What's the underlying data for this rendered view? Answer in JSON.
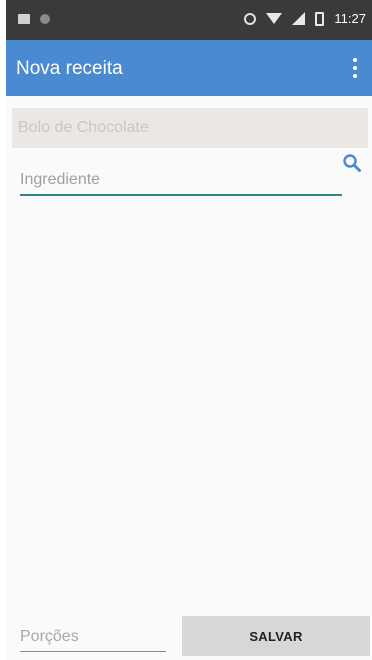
{
  "status_bar": {
    "time": "11:27",
    "icons": [
      "image-icon",
      "circle-icon",
      "alarm-icon",
      "wifi-icon",
      "signal-icon",
      "battery-icon"
    ]
  },
  "app_bar": {
    "title": "Nova receita",
    "menu_icon": "overflow-menu-icon",
    "color": "#4a8ad1"
  },
  "form": {
    "recipe_name": {
      "value": "Bolo de Chocolate",
      "placeholder": "Bolo de Chocolate"
    },
    "ingredient": {
      "placeholder": "Ingrediente",
      "search_icon": "search-icon",
      "accent_color": "#2b8a82"
    },
    "portions": {
      "placeholder": "Porções"
    },
    "save_label": "SALVAR"
  }
}
